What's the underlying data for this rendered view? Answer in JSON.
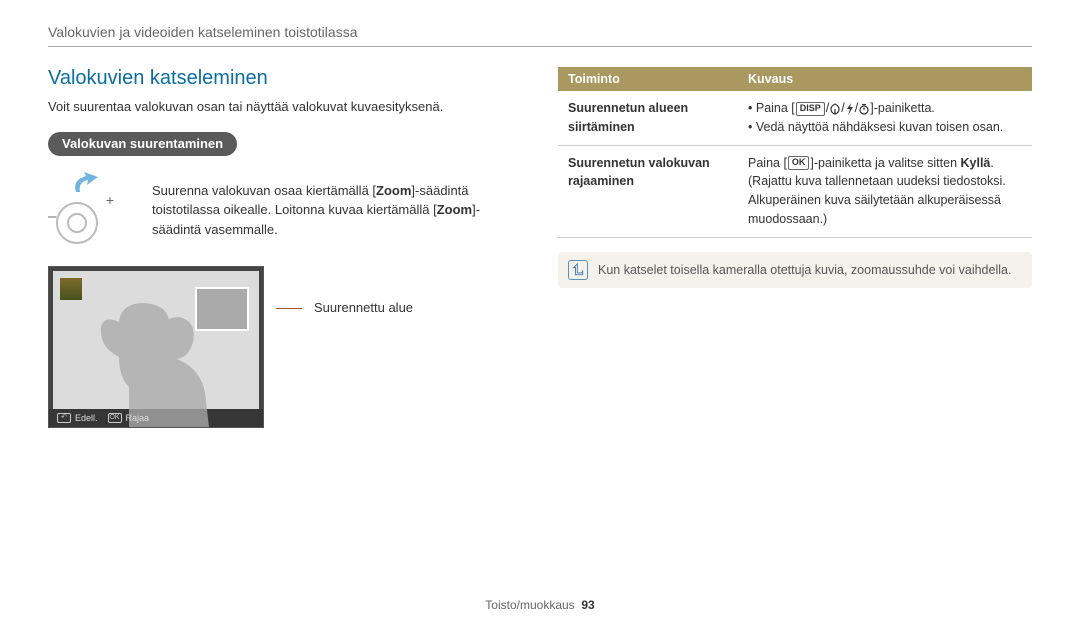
{
  "header": {
    "breadcrumb": "Valokuvien ja videoiden katseleminen toistotilassa"
  },
  "left": {
    "title": "Valokuvien katseleminen",
    "intro": "Voit suurentaa valokuvan osan tai näyttää valokuvat kuvaesityksenä.",
    "pill": "Valokuvan suurentaminen",
    "zoom_text_part1": "Suurenna valokuvan osaa kiertämällä [",
    "zoom_text_bold1": "Zoom",
    "zoom_text_part2": "]-säädintä toistotilassa oikealle. Loitonna kuvaa kiertämällä [",
    "zoom_text_bold2": "Zoom",
    "zoom_text_part3": "]-säädintä vasemmalle.",
    "preview_footer": {
      "back_icon": "↶",
      "back_label": "Edell.",
      "ok_icon": "OK",
      "ok_label": "Rajaa"
    },
    "callout": "Suurennettu alue"
  },
  "right": {
    "table": {
      "head_col1": "Toiminto",
      "head_col2": "Kuvaus",
      "row1": {
        "func": "Suurennetun alueen siirtäminen",
        "bullet1_pre": "Paina [",
        "bullet1_disp": "DISP",
        "bullet1_post": "]-painiketta.",
        "bullet2": "Vedä näyttöä nähdäksesi kuvan toisen osan."
      },
      "row2": {
        "func": "Suurennetun valokuvan rajaaminen",
        "desc_pre": "Paina [",
        "desc_ok": "OK",
        "desc_mid": "]-painiketta ja valitse sitten ",
        "desc_bold": "Kyllä",
        "desc_post": ". (Rajattu kuva tallennetaan uudeksi tiedostoksi. Alkuperäinen kuva säilytetään alkuperäisessä muodossaan.)"
      }
    },
    "note": "Kun katselet toisella kameralla otettuja kuvia, zoomaussuhde voi vaihdella."
  },
  "footer": {
    "section": "Toisto/muokkaus",
    "page": "93"
  }
}
